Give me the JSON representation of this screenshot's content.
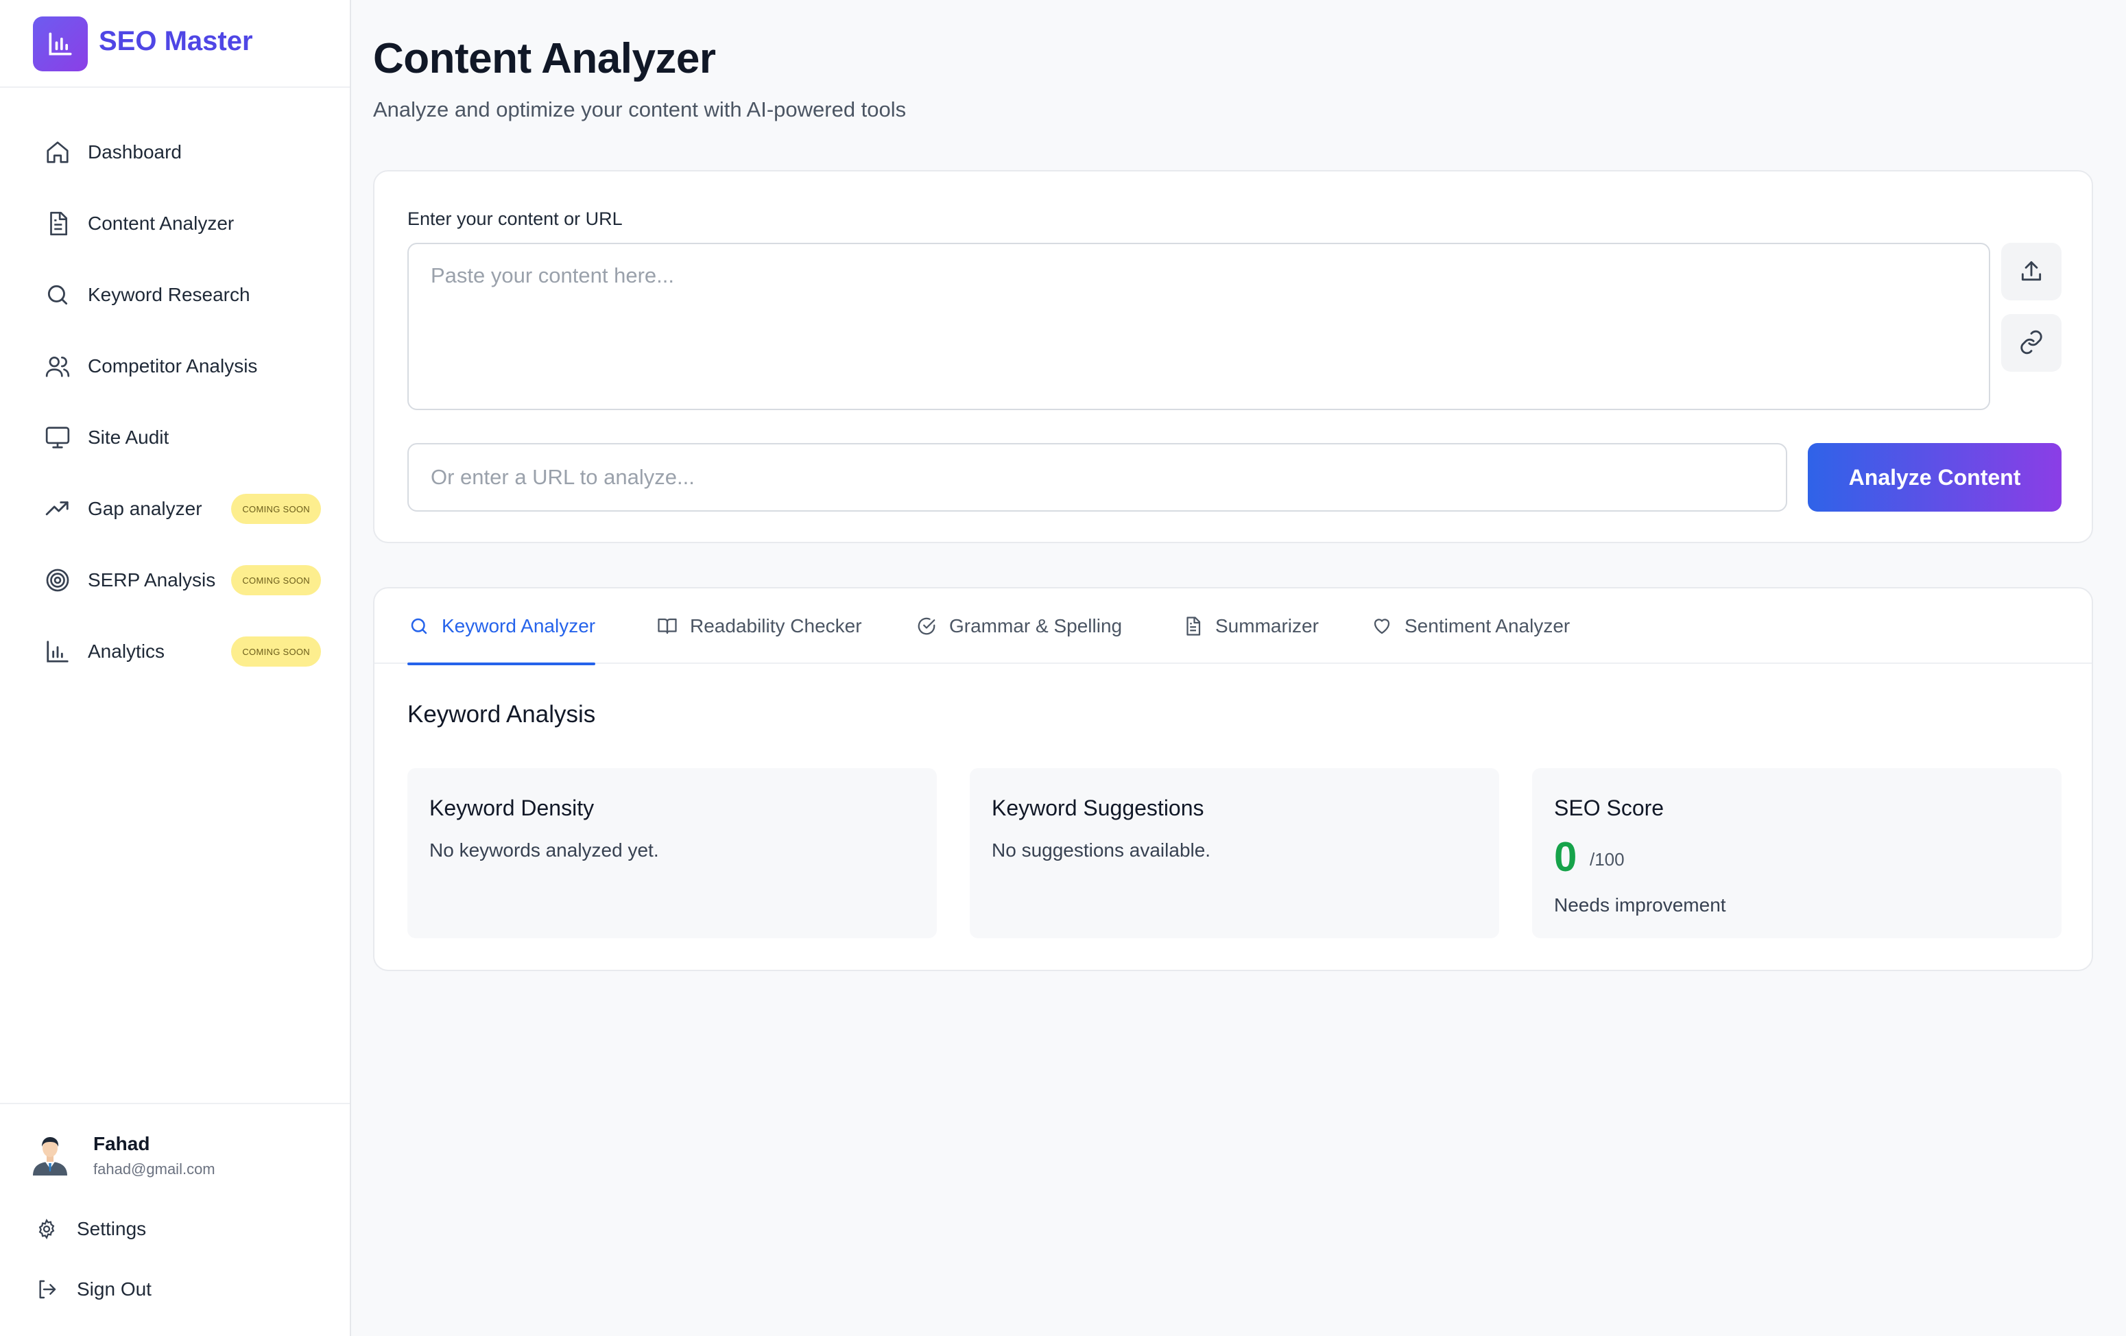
{
  "brand": {
    "name": "SEO Master"
  },
  "sidebar": {
    "items": [
      {
        "label": "Dashboard",
        "icon": "home-icon"
      },
      {
        "label": "Content Analyzer",
        "icon": "document-icon"
      },
      {
        "label": "Keyword Research",
        "icon": "search-icon"
      },
      {
        "label": "Competitor Analysis",
        "icon": "users-icon"
      },
      {
        "label": "Site Audit",
        "icon": "monitor-icon"
      },
      {
        "label": "Gap analyzer",
        "icon": "trending-up-icon",
        "badge": "COMING SOON"
      },
      {
        "label": "SERP Analysis",
        "icon": "target-icon",
        "badge": "COMING SOON"
      },
      {
        "label": "Analytics",
        "icon": "bar-chart-icon",
        "badge": "COMING SOON"
      }
    ]
  },
  "user": {
    "name": "Fahad",
    "email": "fahad@gmail.com"
  },
  "footer": {
    "settings": "Settings",
    "sign_out": "Sign Out"
  },
  "page": {
    "title": "Content Analyzer",
    "subtitle": "Analyze and optimize your content with AI-powered tools"
  },
  "input": {
    "label": "Enter your content or URL",
    "content_placeholder": "Paste your content here...",
    "content_value": "",
    "url_placeholder": "Or enter a URL to analyze...",
    "url_value": "",
    "analyze_label": "Analyze Content"
  },
  "tabs": [
    {
      "label": "Keyword Analyzer",
      "icon": "search-icon",
      "active": true
    },
    {
      "label": "Readability Checker",
      "icon": "book-open-icon",
      "active": false
    },
    {
      "label": "Grammar & Spelling",
      "icon": "check-circle-icon",
      "active": false
    },
    {
      "label": "Summarizer",
      "icon": "document-icon",
      "active": false
    },
    {
      "label": "Sentiment Analyzer",
      "icon": "heart-icon",
      "active": false
    }
  ],
  "analysis": {
    "title": "Keyword Analysis",
    "density": {
      "title": "Keyword Density",
      "text": "No keywords analyzed yet."
    },
    "suggestions": {
      "title": "Keyword Suggestions",
      "text": "No suggestions available."
    },
    "score": {
      "title": "SEO Score",
      "value": "0",
      "max": "/100",
      "status": "Needs improvement"
    }
  },
  "colors": {
    "accent": "#2563eb",
    "brand": "#4f46e5",
    "gradient_start": "#2f63e8",
    "gradient_end": "#8b3ee6",
    "score": "#16a34a",
    "badge": "#fdee8e"
  }
}
